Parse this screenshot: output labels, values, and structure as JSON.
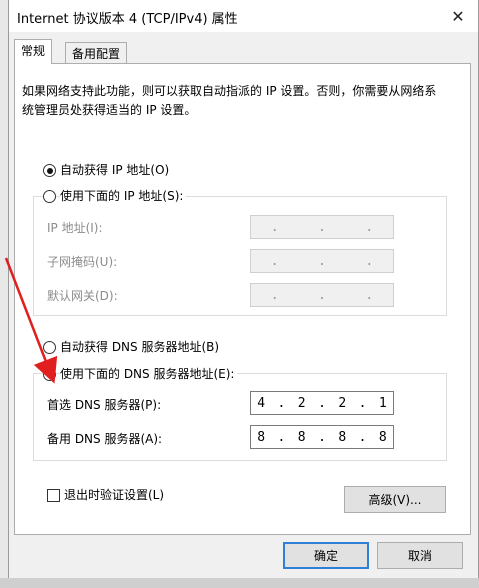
{
  "window": {
    "title": "Internet 协议版本 4 (TCP/IPv4) 属性",
    "close_glyph": "✕"
  },
  "tabs": [
    {
      "label": "常规",
      "active": true
    },
    {
      "label": "备用配置",
      "active": false
    }
  ],
  "description": "如果网络支持此功能，则可以获取自动指派的 IP 设置。否则，你需要从网络系统管理员处获得适当的 IP 设置。",
  "ip_section": {
    "auto_label": "自动获得 IP 地址(O)",
    "manual_label": "使用下面的 IP 地址(S):",
    "selected": "auto",
    "fields": [
      {
        "label": "IP 地址(I):",
        "value": [
          ".",
          ".",
          "."
        ]
      },
      {
        "label": "子网掩码(U):",
        "value": [
          ".",
          ".",
          "."
        ]
      },
      {
        "label": "默认网关(D):",
        "value": [
          ".",
          ".",
          "."
        ]
      }
    ]
  },
  "dns_section": {
    "auto_label": "自动获得 DNS 服务器地址(B)",
    "manual_label": "使用下面的 DNS 服务器地址(E):",
    "selected": "manual",
    "preferred": {
      "label": "首选 DNS 服务器(P):",
      "octets": [
        "4",
        ".",
        "2",
        ".",
        "2",
        ".",
        "1"
      ]
    },
    "alternate": {
      "label": "备用 DNS 服务器(A):",
      "octets": [
        "8",
        ".",
        "8",
        ".",
        "8",
        ".",
        "8"
      ]
    }
  },
  "validate_label": "退出时验证设置(L)",
  "advanced_label": "高级(V)...",
  "ok_label": "确定",
  "cancel_label": "取消",
  "colors": {
    "accent": "#2f7fd6",
    "arrow": "#e02020"
  }
}
